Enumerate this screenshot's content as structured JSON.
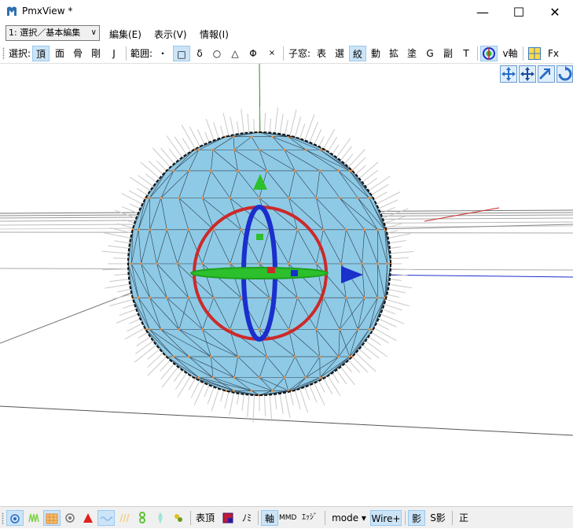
{
  "window": {
    "title": "PmxView *",
    "min_symbol": "—",
    "max_symbol": "☐",
    "close_symbol": "✕"
  },
  "menubar": {
    "mode_select": "1: 選択／基本編集",
    "edit": "編集(E)",
    "view": "表示(V)",
    "info": "情報(I)"
  },
  "toolbar": {
    "select_label": "選択:",
    "sel_vertex": "頂",
    "sel_face": "面",
    "sel_bone": "骨",
    "sel_rigid": "剛",
    "sel_joint": "J",
    "range_label": "範囲:",
    "range_point": "・",
    "range_rect": "□",
    "range_delta": "δ",
    "range_circle": "○",
    "range_triangle": "△",
    "range_phi": "Φ",
    "range_x": "×",
    "child_label": "子窓:",
    "child_table": "表",
    "child_select": "選",
    "child_narrow": "絞",
    "child_move": "動",
    "child_scale": "拡",
    "child_paint": "塗",
    "child_g": "G",
    "child_sub": "副",
    "child_t": "T",
    "vaxis_label": "v軸",
    "fx_label": "Fx"
  },
  "viewport_controls": [
    "move-icon",
    "pan-icon",
    "zoom-icon",
    "rotate-icon"
  ],
  "statusbar": {
    "vertex_label": "表頂",
    "nomi_label": "ﾉﾐ",
    "axis_label": "軸",
    "mmd_label": "MMD",
    "edge_label": "ｴｯｼﾞ",
    "mode_label": "mode ▾",
    "wire_label": "Wire+",
    "shadow_label": "影",
    "sshadow_label": "S影",
    "ortho_label": "正"
  },
  "colors": {
    "sphere": "#8ecae6",
    "gizmo_red": "#cc2a2a",
    "gizmo_blue": "#1a2fcc",
    "gizmo_green": "#2cc02c",
    "active_button": "#cce4f7"
  }
}
